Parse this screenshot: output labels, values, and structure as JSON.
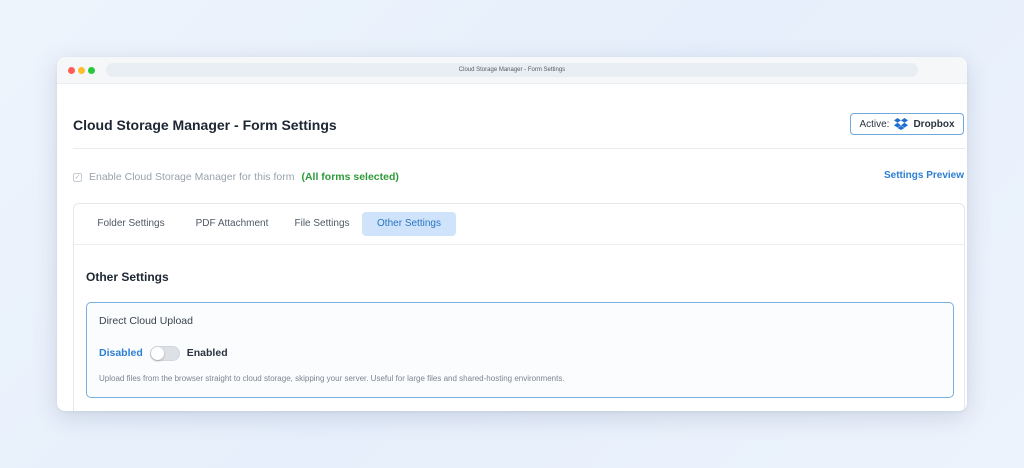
{
  "window": {
    "url_title": "Cloud Storage Manager - Form Settings"
  },
  "header": {
    "title": "Cloud Storage Manager - Form Settings",
    "active_label": "Active:",
    "active_service": "Dropbox",
    "service_icon": "dropbox-icon",
    "badge_border_color": "#6fa8dc"
  },
  "enable": {
    "checked": true,
    "label": "Enable Cloud Storage Manager for this form",
    "note": "(All forms selected)",
    "note_color": "#2f9a3a"
  },
  "settings_preview_label": "Settings Preview",
  "tabs": [
    {
      "label": "Folder Settings",
      "active": false
    },
    {
      "label": "PDF Attachment",
      "active": false
    },
    {
      "label": "File Settings",
      "active": false
    },
    {
      "label": "Other Settings",
      "active": true
    }
  ],
  "other_settings": {
    "title": "Other Settings",
    "direct_upload": {
      "title": "Direct Cloud Upload",
      "disabled_label": "Disabled",
      "enabled_label": "Enabled",
      "enabled": false,
      "description": "Upload files from the browser straight to cloud storage, skipping your server. Useful for large files and shared-hosting environments."
    }
  },
  "colors": {
    "accent": "#2d7fd3",
    "active_tab_bg": "#cfe4fb",
    "card_border": "#7aaee0"
  }
}
